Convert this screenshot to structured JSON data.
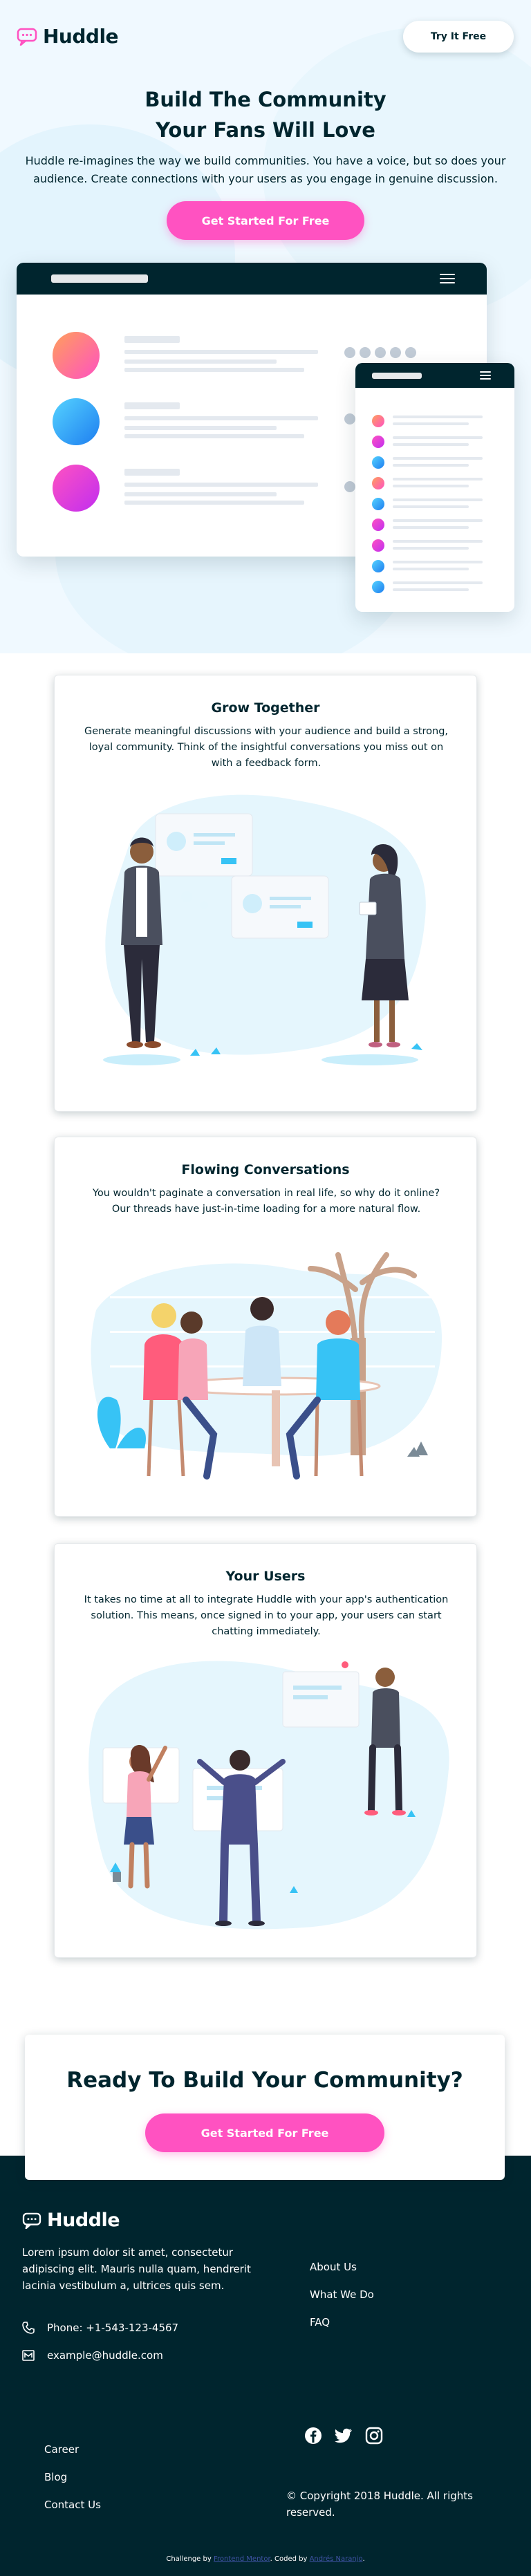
{
  "header": {
    "logo_text": "Huddle",
    "try_button": "Try It Free"
  },
  "hero": {
    "title_line1": "Build The Community",
    "title_line2": "Your Fans Will Love",
    "description": "Huddle re-imagines the way we build communities. You have a voice, but so does your audience. Create connections with your users as you engage in genuine discussion.",
    "cta": "Get Started For Free"
  },
  "features": [
    {
      "title": "Grow Together",
      "description": "Generate meaningful discussions with your audience and build a strong, loyal community. Think of the insightful conversations you miss out on with a feedback form."
    },
    {
      "title": "Flowing Conversations",
      "description": "You wouldn't paginate a conversation in real life, so why do it online? Our threads have just-in-time loading for a more natural flow."
    },
    {
      "title": "Your Users",
      "description": "It takes no time at all to integrate Huddle with your app's authentication solution. This means, once signed in to your app, your users can start chatting immediately."
    }
  ],
  "cta_section": {
    "title": "Ready To Build Your Community?",
    "button": "Get Started For Free"
  },
  "footer": {
    "logo_text": "Huddle",
    "about": "Lorem ipsum dolor sit amet, consectetur adipiscing elit. Mauris nulla quam, hendrerit lacinia vestibulum a, ultrices quis sem.",
    "phone": "Phone: +1-543-123-4567",
    "email": "example@huddle.com",
    "links_right": [
      "About Us",
      "What We Do",
      "FAQ"
    ],
    "links_left": [
      "Career",
      "Blog",
      "Contact Us"
    ],
    "social_icons": [
      "facebook-icon",
      "twitter-icon",
      "instagram-icon"
    ],
    "copyright": "© Copyright 2018 Huddle. All rights reserved.",
    "attribution_prefix": "Challenge by",
    "attribution_link1": "Frontend Mentor",
    "attribution_mid": ". Coded by",
    "attribution_link2": "Andrés Naranjo",
    "attribution_end": "."
  },
  "colors": {
    "primary_pink": "#ff52c1",
    "dark_blue": "#00252e",
    "hero_bg": "#f0f9ff"
  }
}
